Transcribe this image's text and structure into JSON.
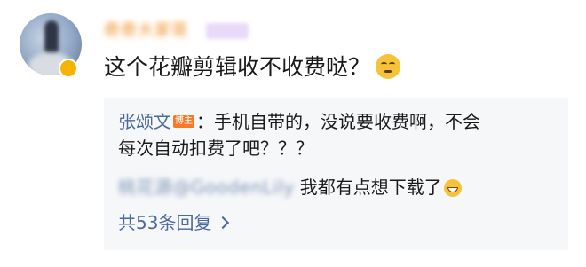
{
  "comment": {
    "username": "奇奇大家哥",
    "text": "这个花瓣剪辑收不收费哒？",
    "emoji_icon": "smirk-face-icon"
  },
  "replies": [
    {
      "author": "张颂文",
      "badge": "博主",
      "text_line1": "：手机自带的，没说要收费啊，不会",
      "text_line2": "每次自动扣费了吧？？？"
    },
    {
      "author": "桃花源@GoodenLily",
      "text": "我都有点想下载了",
      "emoji_icon": "laughing-tears-icon"
    }
  ],
  "reply_count_label": "共53条回复",
  "colors": {
    "link": "#4a6a9a",
    "username": "#f08a1c",
    "badge": "#f77a2b",
    "reply_bg": "#f6f7f9"
  }
}
